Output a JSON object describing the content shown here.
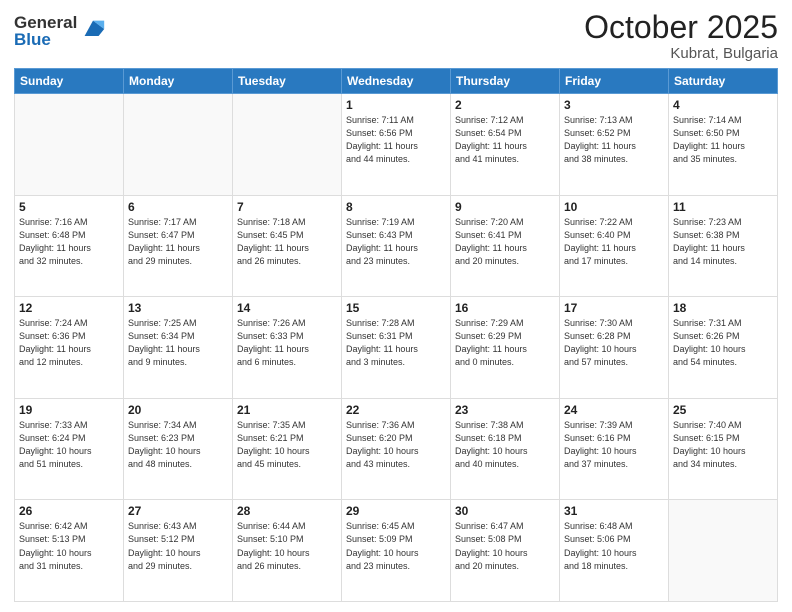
{
  "header": {
    "logo_general": "General",
    "logo_blue": "Blue",
    "month": "October 2025",
    "location": "Kubrat, Bulgaria"
  },
  "weekdays": [
    "Sunday",
    "Monday",
    "Tuesday",
    "Wednesday",
    "Thursday",
    "Friday",
    "Saturday"
  ],
  "weeks": [
    [
      {
        "day": "",
        "info": ""
      },
      {
        "day": "",
        "info": ""
      },
      {
        "day": "",
        "info": ""
      },
      {
        "day": "1",
        "info": "Sunrise: 7:11 AM\nSunset: 6:56 PM\nDaylight: 11 hours\nand 44 minutes."
      },
      {
        "day": "2",
        "info": "Sunrise: 7:12 AM\nSunset: 6:54 PM\nDaylight: 11 hours\nand 41 minutes."
      },
      {
        "day": "3",
        "info": "Sunrise: 7:13 AM\nSunset: 6:52 PM\nDaylight: 11 hours\nand 38 minutes."
      },
      {
        "day": "4",
        "info": "Sunrise: 7:14 AM\nSunset: 6:50 PM\nDaylight: 11 hours\nand 35 minutes."
      }
    ],
    [
      {
        "day": "5",
        "info": "Sunrise: 7:16 AM\nSunset: 6:48 PM\nDaylight: 11 hours\nand 32 minutes."
      },
      {
        "day": "6",
        "info": "Sunrise: 7:17 AM\nSunset: 6:47 PM\nDaylight: 11 hours\nand 29 minutes."
      },
      {
        "day": "7",
        "info": "Sunrise: 7:18 AM\nSunset: 6:45 PM\nDaylight: 11 hours\nand 26 minutes."
      },
      {
        "day": "8",
        "info": "Sunrise: 7:19 AM\nSunset: 6:43 PM\nDaylight: 11 hours\nand 23 minutes."
      },
      {
        "day": "9",
        "info": "Sunrise: 7:20 AM\nSunset: 6:41 PM\nDaylight: 11 hours\nand 20 minutes."
      },
      {
        "day": "10",
        "info": "Sunrise: 7:22 AM\nSunset: 6:40 PM\nDaylight: 11 hours\nand 17 minutes."
      },
      {
        "day": "11",
        "info": "Sunrise: 7:23 AM\nSunset: 6:38 PM\nDaylight: 11 hours\nand 14 minutes."
      }
    ],
    [
      {
        "day": "12",
        "info": "Sunrise: 7:24 AM\nSunset: 6:36 PM\nDaylight: 11 hours\nand 12 minutes."
      },
      {
        "day": "13",
        "info": "Sunrise: 7:25 AM\nSunset: 6:34 PM\nDaylight: 11 hours\nand 9 minutes."
      },
      {
        "day": "14",
        "info": "Sunrise: 7:26 AM\nSunset: 6:33 PM\nDaylight: 11 hours\nand 6 minutes."
      },
      {
        "day": "15",
        "info": "Sunrise: 7:28 AM\nSunset: 6:31 PM\nDaylight: 11 hours\nand 3 minutes."
      },
      {
        "day": "16",
        "info": "Sunrise: 7:29 AM\nSunset: 6:29 PM\nDaylight: 11 hours\nand 0 minutes."
      },
      {
        "day": "17",
        "info": "Sunrise: 7:30 AM\nSunset: 6:28 PM\nDaylight: 10 hours\nand 57 minutes."
      },
      {
        "day": "18",
        "info": "Sunrise: 7:31 AM\nSunset: 6:26 PM\nDaylight: 10 hours\nand 54 minutes."
      }
    ],
    [
      {
        "day": "19",
        "info": "Sunrise: 7:33 AM\nSunset: 6:24 PM\nDaylight: 10 hours\nand 51 minutes."
      },
      {
        "day": "20",
        "info": "Sunrise: 7:34 AM\nSunset: 6:23 PM\nDaylight: 10 hours\nand 48 minutes."
      },
      {
        "day": "21",
        "info": "Sunrise: 7:35 AM\nSunset: 6:21 PM\nDaylight: 10 hours\nand 45 minutes."
      },
      {
        "day": "22",
        "info": "Sunrise: 7:36 AM\nSunset: 6:20 PM\nDaylight: 10 hours\nand 43 minutes."
      },
      {
        "day": "23",
        "info": "Sunrise: 7:38 AM\nSunset: 6:18 PM\nDaylight: 10 hours\nand 40 minutes."
      },
      {
        "day": "24",
        "info": "Sunrise: 7:39 AM\nSunset: 6:16 PM\nDaylight: 10 hours\nand 37 minutes."
      },
      {
        "day": "25",
        "info": "Sunrise: 7:40 AM\nSunset: 6:15 PM\nDaylight: 10 hours\nand 34 minutes."
      }
    ],
    [
      {
        "day": "26",
        "info": "Sunrise: 6:42 AM\nSunset: 5:13 PM\nDaylight: 10 hours\nand 31 minutes."
      },
      {
        "day": "27",
        "info": "Sunrise: 6:43 AM\nSunset: 5:12 PM\nDaylight: 10 hours\nand 29 minutes."
      },
      {
        "day": "28",
        "info": "Sunrise: 6:44 AM\nSunset: 5:10 PM\nDaylight: 10 hours\nand 26 minutes."
      },
      {
        "day": "29",
        "info": "Sunrise: 6:45 AM\nSunset: 5:09 PM\nDaylight: 10 hours\nand 23 minutes."
      },
      {
        "day": "30",
        "info": "Sunrise: 6:47 AM\nSunset: 5:08 PM\nDaylight: 10 hours\nand 20 minutes."
      },
      {
        "day": "31",
        "info": "Sunrise: 6:48 AM\nSunset: 5:06 PM\nDaylight: 10 hours\nand 18 minutes."
      },
      {
        "day": "",
        "info": ""
      }
    ]
  ]
}
